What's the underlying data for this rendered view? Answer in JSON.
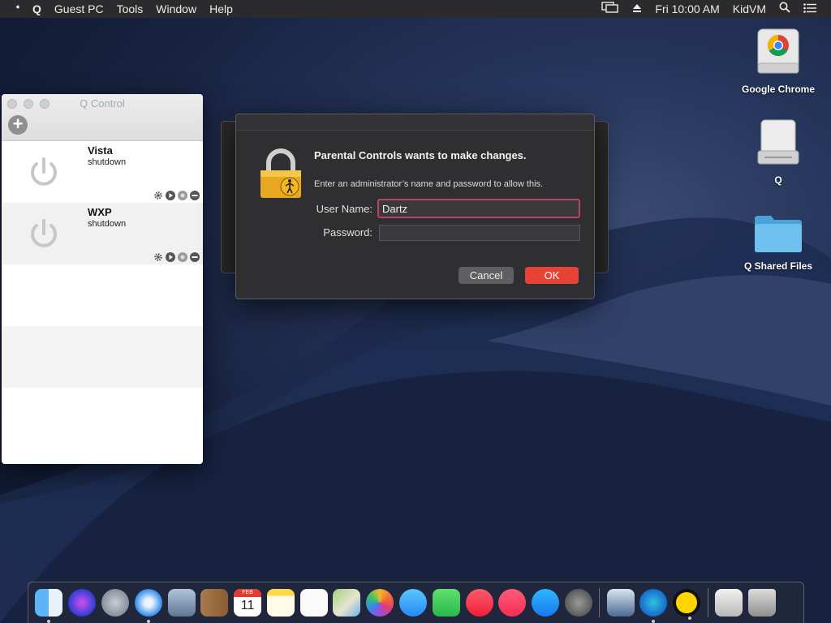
{
  "menubar": {
    "app": "Q",
    "items": [
      "Guest PC",
      "Tools",
      "Window",
      "Help"
    ],
    "clock": "Fri 10:00 AM",
    "user": "KidVM"
  },
  "qcontrol": {
    "title": "Q Control",
    "vms": [
      {
        "name": "Vista",
        "state": "shutdown"
      },
      {
        "name": "WXP",
        "state": "shutdown"
      }
    ]
  },
  "dialog": {
    "heading": "Parental Controls wants to make changes.",
    "message": "Enter an administrator’s name and password to allow this.",
    "user_label": "User Name:",
    "user_value": "Dartz",
    "password_label": "Password:",
    "cancel_label": "Cancel",
    "ok_label": "OK",
    "accent": "#e64336"
  },
  "desktop_icons": [
    {
      "label": "Google Chrome",
      "icon": "chrome-disk-icon"
    },
    {
      "label": "Q",
      "icon": "drive-icon"
    },
    {
      "label": "Q Shared Files",
      "icon": "folder-icon"
    }
  ],
  "dock": {
    "items": [
      "finder",
      "siri",
      "launchpad",
      "safari",
      "mail",
      "contacts",
      "calendar",
      "notes",
      "reminders",
      "maps",
      "photos",
      "messages",
      "facetime",
      "news",
      "music",
      "app-store",
      "system-preferences",
      "virtualbox",
      "edge",
      "qemu",
      "downloads",
      "trash"
    ],
    "calendar_month": "FEB",
    "calendar_day": "11"
  }
}
